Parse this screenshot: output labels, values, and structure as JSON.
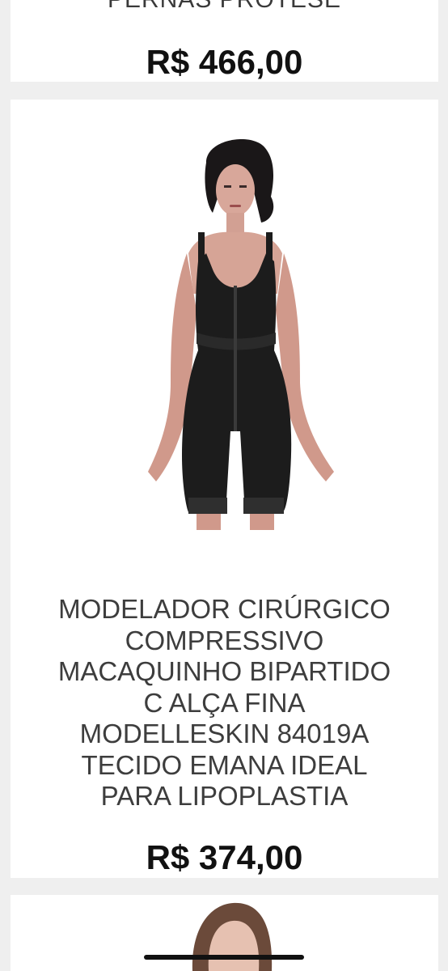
{
  "products": [
    {
      "title": "PERNAS PRÓTESE",
      "price": "R$ 466,00"
    },
    {
      "title": "MODELADOR CIRÚRGICO\nCOMPRESSIVO\nMACAQUINHO BIPARTIDO\nC ALÇA FINA\nMODELLESKIN 84019A\nTECIDO EMANA IDEAL\nPARA LIPOPLASTIA",
      "price": "R$ 374,00",
      "image": "woman-wearing-black-compression-bodysuit"
    },
    {
      "image": "woman-portrait-partial"
    }
  ],
  "colors": {
    "page_background": "#efefef",
    "card_background": "#ffffff",
    "price_text": "#111111",
    "title_text": "#3d3d3d"
  }
}
